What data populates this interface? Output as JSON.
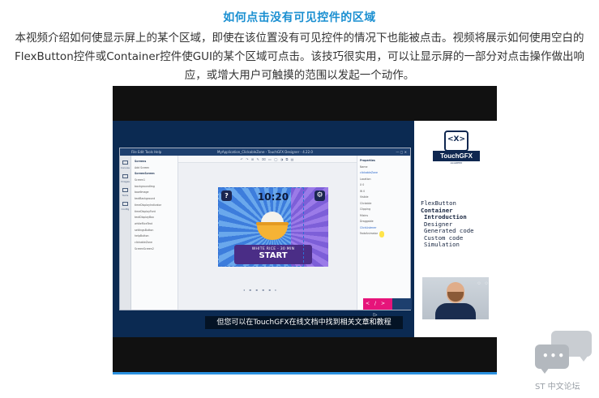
{
  "article": {
    "title": "如何点击没有可见控件的区域",
    "description": "本视频介绍如何使显示屏上的某个区域，即使在该位置没有可见控件的情况下也能被点击。视频将展示如何使用空白的FlexButton控件或Container控件使GUI的某个区域可点击。该技巧很实用，可以让显示屏的一部分对点击操作做出响应，或增大用户可触摸的范围以发起一个动作。"
  },
  "video": {
    "subtitle": "但您可以在TouchGFX在线文档中找到相关文章和教程",
    "designer": {
      "window_title": "MyApplication_ClickableZone - TouchGFX Designer - 4.22.0",
      "menu": "File   Edit   Tools   Help",
      "toolbar": "↶ ↷  ⊞  ✎  ⌧  ▭  ◯  ◑  ⧉  ▤",
      "left_nav": [
        "Canvas",
        "Images",
        "Texts",
        "Config"
      ],
      "tree_header": "Screens",
      "tree": [
        "Add Screen",
        "ScreenScreen",
        "Screen1",
        "backgroundImg",
        "bowlImage",
        "textBackground",
        "timeDisplayIndicator",
        "timeDisplayFont",
        "textDisplayBox",
        "whiteRiceText",
        "settingsButton",
        "helpButton",
        "clickableZone",
        "ScreenScreen2"
      ],
      "props_header": "Properties",
      "props": [
        "Name",
        "clickableZone",
        "Location",
        "X  0",
        "W  0",
        "Visible",
        "Clickable",
        "Clipping",
        "Mixins",
        "Draggable",
        "ClickListener",
        "FadeAnimator"
      ],
      "pager": "◂ ▪ ▪ ▪ ▪ ▸",
      "code_button": "</> ▷"
    },
    "app": {
      "time": "10:20",
      "help_icon": "?",
      "settings_icon": "⚙",
      "rice_label": "WHITE RICE - 30 MIN",
      "start_label": "START"
    },
    "promo": {
      "logo_icon": "<X>",
      "brand": "TouchGFX",
      "academy": "ACADEMY",
      "topics": [
        {
          "text": "FlexButton",
          "style": ""
        },
        {
          "text": "Container",
          "style": "b"
        },
        {
          "text": "Introduction",
          "style": "i2"
        },
        {
          "text": "Designer",
          "style": "i1"
        },
        {
          "text": "Generated code",
          "style": "i1"
        },
        {
          "text": "Custom code",
          "style": "i1"
        },
        {
          "text": "Simulation",
          "style": "i1"
        }
      ]
    }
  },
  "watermark": {
    "label": "ST 中文论坛"
  },
  "colors": {
    "title": "#1a8fd1",
    "video_bar": "#2b91e0",
    "accent": "#e6147a",
    "brand": "#0f2750"
  }
}
